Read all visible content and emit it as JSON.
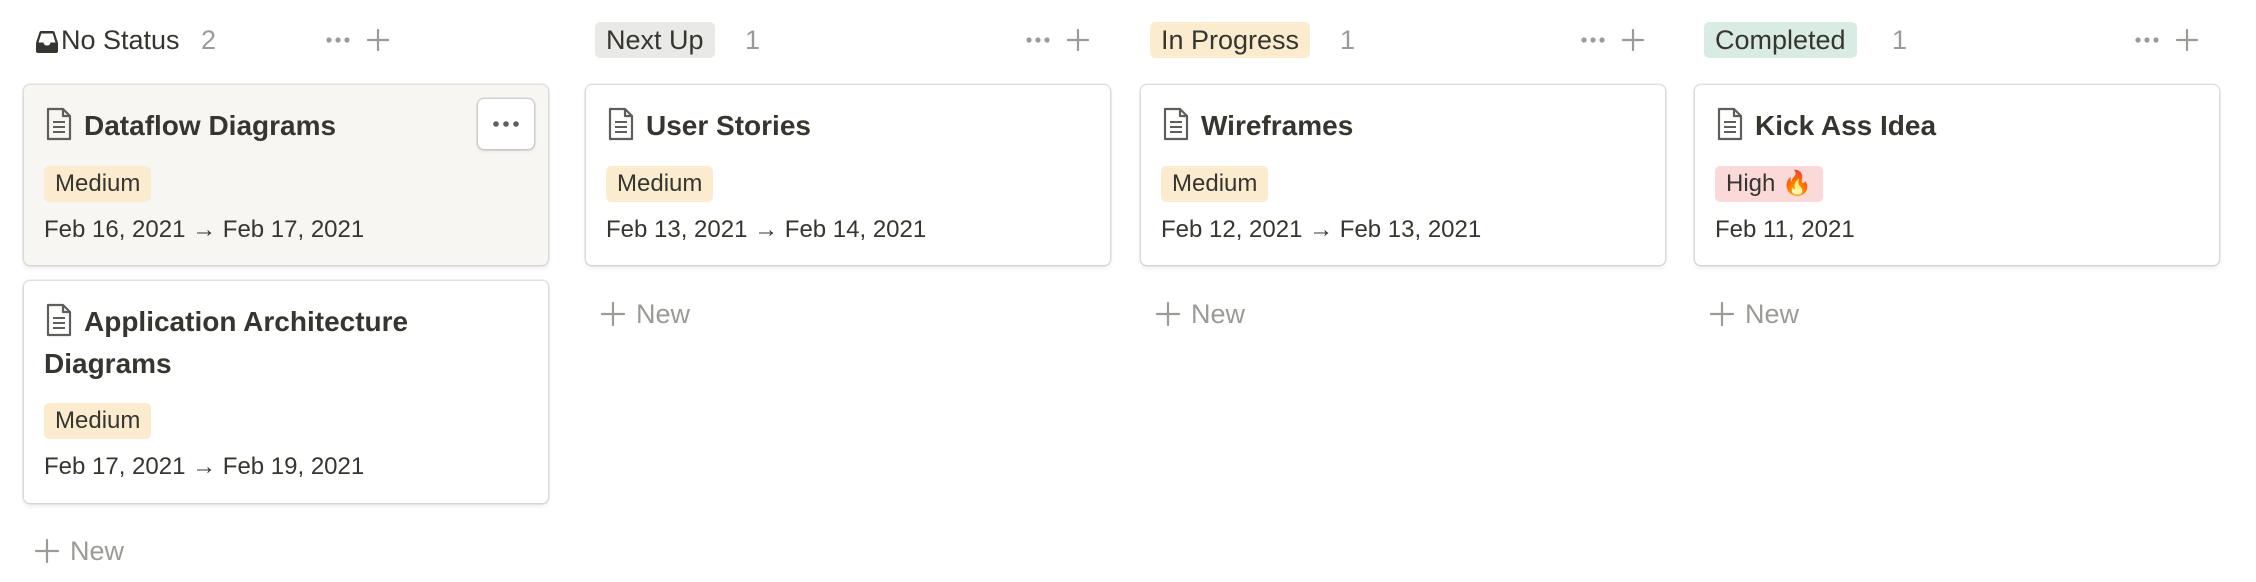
{
  "columns": [
    {
      "title": "No Status",
      "count": "2",
      "title_bg": "",
      "cards": [
        {
          "title": "Dataflow Diagrams",
          "tag": "Medium",
          "tag_bg": "#fbeccf",
          "date": "Feb 16, 2021 → Feb 17, 2021"
        },
        {
          "title": "Application Architecture Diagrams",
          "tag": "Medium",
          "tag_bg": "#fbeccf",
          "date": "Feb 17, 2021 → Feb 19, 2021"
        }
      ],
      "new_label": "New"
    },
    {
      "title": "Next Up",
      "count": "1",
      "title_bg": "#e9e9e7",
      "cards": [
        {
          "title": "User Stories",
          "tag": "Medium",
          "tag_bg": "#fbeccf",
          "date": "Feb 13, 2021 → Feb 14, 2021"
        }
      ],
      "new_label": "New"
    },
    {
      "title": "In Progress",
      "count": "1",
      "title_bg": "#fbeccf",
      "cards": [
        {
          "title": "Wireframes",
          "tag": "Medium",
          "tag_bg": "#fbeccf",
          "date": "Feb 12, 2021 → Feb 13, 2021"
        }
      ],
      "new_label": "New"
    },
    {
      "title": "Completed",
      "count": "1",
      "title_bg": "#d9ece3",
      "cards": [
        {
          "title": "Kick Ass Idea",
          "tag": "High 🔥",
          "tag_bg": "#fbd9d9",
          "date": "Feb 11, 2021"
        }
      ],
      "new_label": "New"
    }
  ],
  "icons": {
    "column_header": [
      "inbox-icon",
      "more-horizontal-icon",
      "plus-icon"
    ],
    "card": "page-document-icon",
    "card_hover_menu": "more-horizontal-icon"
  },
  "colors": {
    "text": "#37352f",
    "muted": "#9b9a97",
    "hover_card": "#f7f6f3"
  }
}
